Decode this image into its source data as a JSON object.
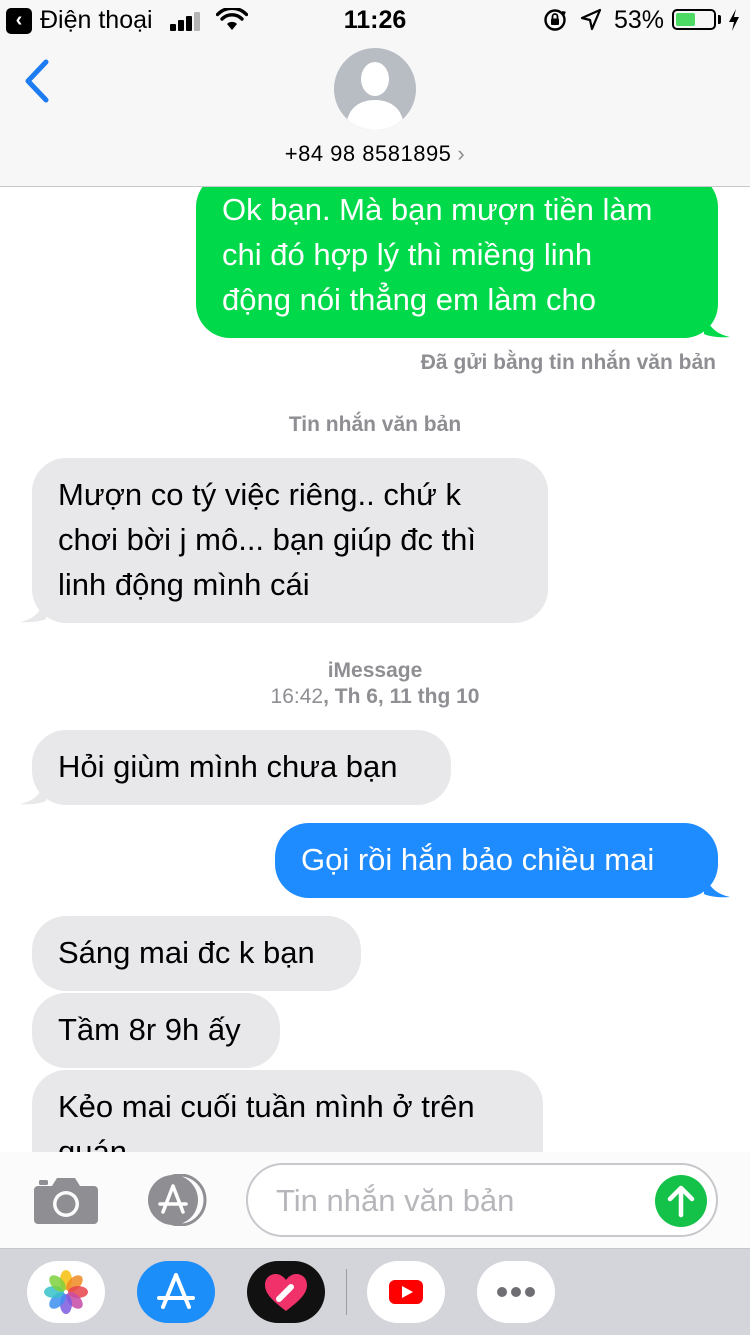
{
  "status_bar": {
    "back_app": "Điện thoại",
    "time": "11:26",
    "battery_percent_text": "53%",
    "battery_level": 0.53
  },
  "header": {
    "contact_number": "+84 98 8581895"
  },
  "thread": {
    "messages": [
      {
        "direction": "outgoing",
        "kind": "sms",
        "lines": [
          "Ok bạn. Mà bạn mượn tiền làm",
          "chi đó hợp lý thì miềng linh",
          "động nói thẳng em làm cho"
        ]
      },
      {
        "direction": "incoming",
        "lines": [
          "Mượn co tý việc riêng.. chứ k",
          "chơi bời j mô... bạn giúp đc thì",
          "linh động mình cái"
        ]
      },
      {
        "direction": "incoming",
        "lines": [
          "Hỏi giùm mình chưa bạn"
        ]
      },
      {
        "direction": "outgoing",
        "kind": "imessage",
        "lines": [
          "Gọi rồi hắn bảo chiều mai"
        ]
      },
      {
        "direction": "incoming",
        "lines": [
          "Sáng mai đc k bạn"
        ]
      },
      {
        "direction": "incoming",
        "lines": [
          "Tầm 8r 9h ấy"
        ]
      },
      {
        "direction": "incoming",
        "lines": [
          "Kẻo mai cuối tuần mình ở trên",
          "quán"
        ]
      }
    ],
    "sent_as_text_note": "Đã gửi bằng tin nhắn văn bản",
    "text_message_label": "Tin nhắn văn bản",
    "imessage_label": "iMessage",
    "timestamp_time": "16:42",
    "timestamp_date": ", Th 6, 11 thg 10"
  },
  "input": {
    "placeholder": "Tin nhắn văn bản"
  },
  "drawer": {
    "apps": [
      "photos-app-icon",
      "app-store-icon",
      "digital-touch-icon",
      "youtube-icon",
      "more-apps-icon"
    ]
  },
  "colors": {
    "sms_green": "#00d94a",
    "imessage_blue": "#1e8bff",
    "incoming_gray": "#e8e8eb",
    "ios_blue": "#1e7cf2"
  }
}
